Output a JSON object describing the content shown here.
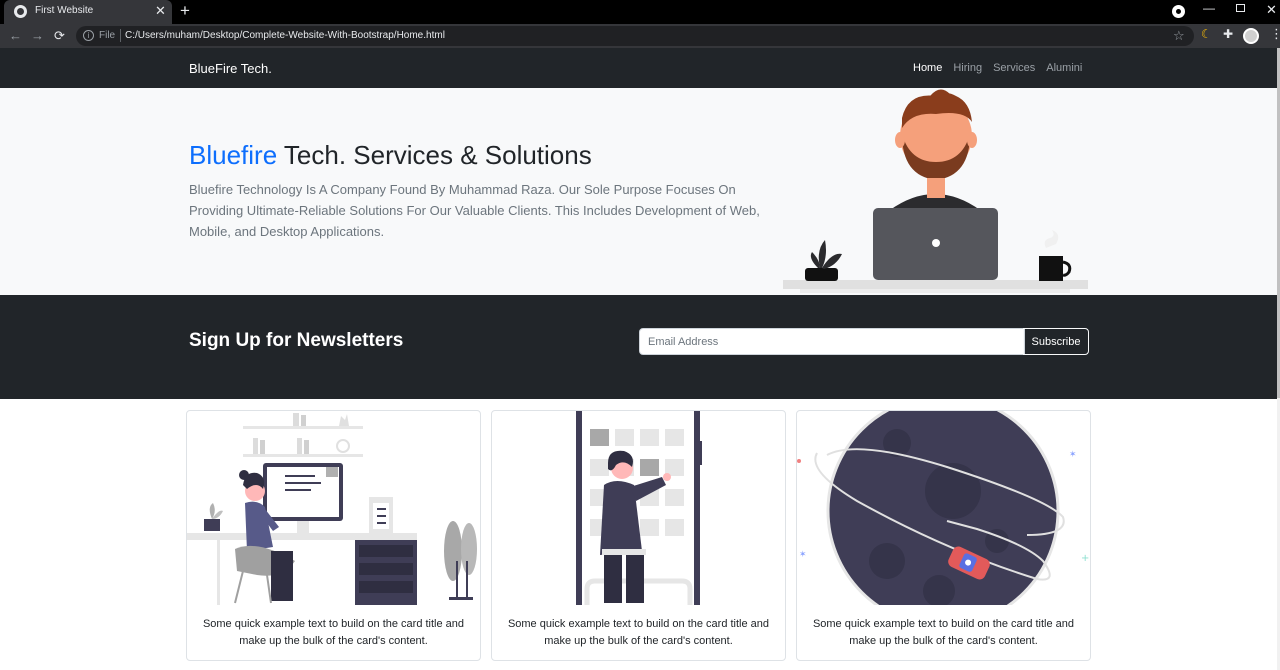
{
  "browser": {
    "tab_title": "First Website",
    "tab_close": "✕",
    "new_tab": "+",
    "back": "←",
    "forward": "→",
    "reload": "⟳",
    "omnibox_scheme": "File",
    "url": "C:/Users/muham/Desktop/Complete-Website-With-Bootstrap/Home.html",
    "star": "☆",
    "win_min": "—",
    "win_close": "✕"
  },
  "navbar": {
    "brand": "BlueFire Tech.",
    "links": [
      {
        "label": "Home",
        "active": true
      },
      {
        "label": "Hiring",
        "active": false
      },
      {
        "label": "Services",
        "active": false
      },
      {
        "label": "Alumini",
        "active": false
      }
    ]
  },
  "hero": {
    "title_accent": "Bluefire",
    "title_rest": " Tech. Services & Solutions",
    "lead": "Bluefire Technology Is A Company Found By Muhammad Raza. Our Sole Purpose Focuses On Providing Ultimate-Reliable Solutions For Our Valuable Clients. This Includes Development of Web, Mobile, and Desktop Applications.",
    "accent_color": "#0d6efd"
  },
  "newsletter": {
    "title": "Sign Up for Newsletters",
    "email_placeholder": "Email Address",
    "email_value": "",
    "button": "Subscribe"
  },
  "cards": [
    {
      "image_icon": "woman-at-desk-illustration",
      "text": "Some quick example text to build on the card title and make up the bulk of the card's content."
    },
    {
      "image_icon": "man-choosing-tiles-illustration",
      "text": "Some quick example text to build on the card title and make up the bulk of the card's content."
    },
    {
      "image_icon": "planet-car-orbit-illustration",
      "text": "Some quick example text to build on the card title and make up the bulk of the card's content."
    }
  ],
  "colors": {
    "dark": "#212529",
    "light": "#f8f9fa",
    "primary": "#0d6efd"
  }
}
